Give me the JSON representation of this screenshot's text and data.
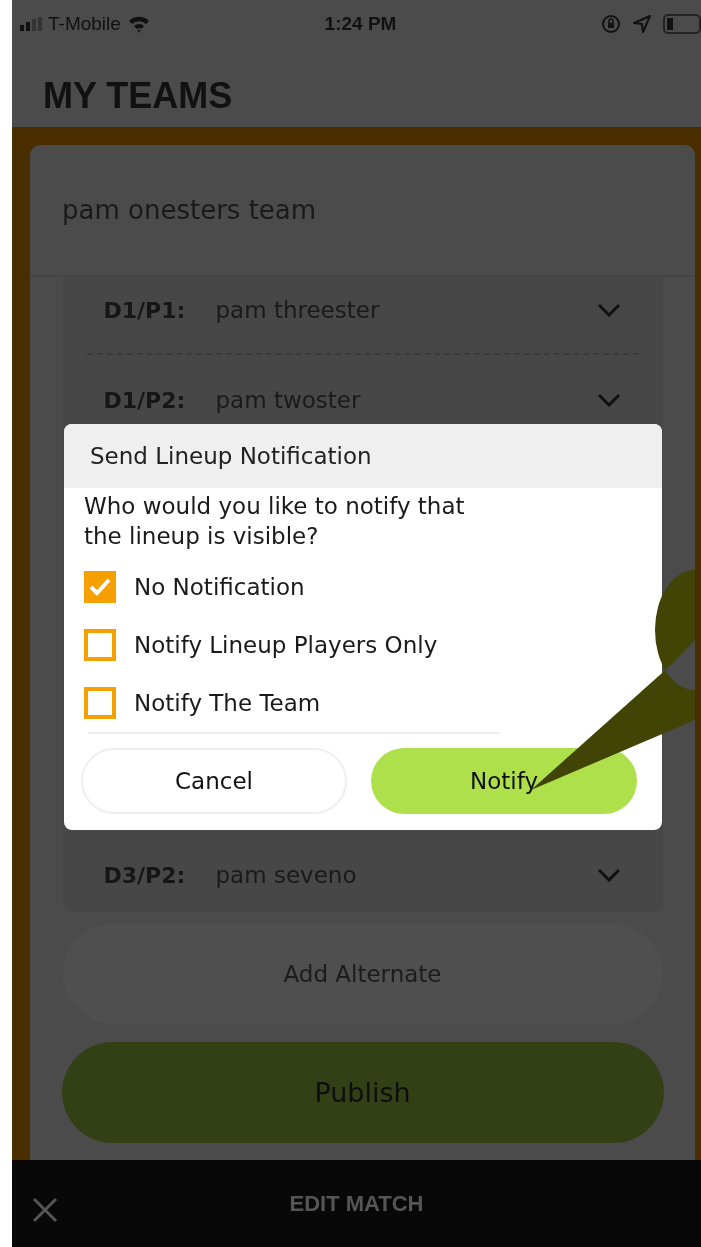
{
  "status_bar": {
    "carrier": "T-Mobile",
    "time": "1:24 PM"
  },
  "header": {
    "title": "MY TEAMS"
  },
  "team": {
    "name": "pam onesters team",
    "lineup": [
      {
        "position": "D1/P1:",
        "player": "pam threester"
      },
      {
        "position": "D1/P2:",
        "player": "pam twoster"
      },
      {
        "position": "D3/P2:",
        "player": "pam seveno"
      }
    ]
  },
  "add_alternate_button": "Add Alternate",
  "publish_button": "Publish",
  "dialog": {
    "title": "Send Lineup Notification",
    "message": "Who would you like to notify that the lineup is visible?",
    "options": [
      {
        "label": "No Notification",
        "checked": true
      },
      {
        "label": "Notify Lineup Players Only",
        "checked": false
      },
      {
        "label": "Notify The Team",
        "checked": false
      }
    ],
    "buttons": [
      {
        "label": "Cancel",
        "kind": "secondary"
      },
      {
        "label": "Notify",
        "kind": "primary"
      }
    ]
  },
  "bottom_bar": {
    "title": "EDIT MATCH"
  }
}
